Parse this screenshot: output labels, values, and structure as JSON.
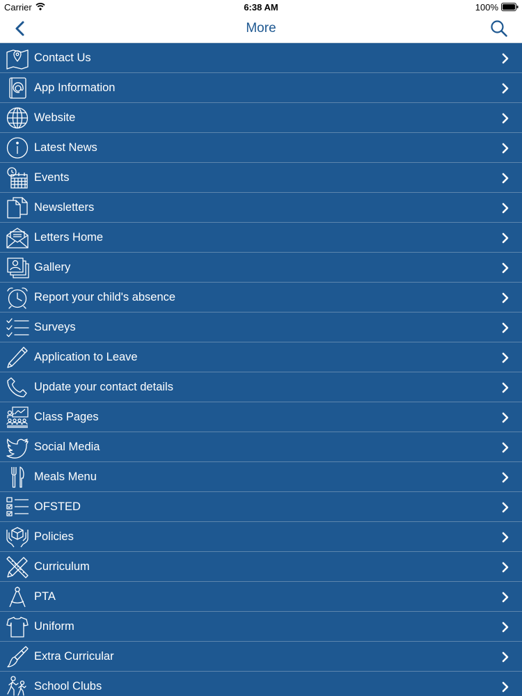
{
  "status_bar": {
    "carrier": "Carrier",
    "time": "6:38 AM",
    "battery": "100%"
  },
  "header": {
    "title": "More",
    "back_icon": "chevron-left-icon",
    "search_icon": "search-icon"
  },
  "colors": {
    "row_bg": "#1e5891",
    "divider": "#5c85ad",
    "title": "#1e5891"
  },
  "menu": {
    "items": [
      {
        "label": "Contact Us",
        "icon": "map-pin-icon"
      },
      {
        "label": "App Information",
        "icon": "address-book-icon"
      },
      {
        "label": "Website",
        "icon": "globe-icon"
      },
      {
        "label": "Latest News",
        "icon": "info-icon"
      },
      {
        "label": "Events",
        "icon": "calendar-clock-icon"
      },
      {
        "label": "Newsletters",
        "icon": "document-icon"
      },
      {
        "label": "Letters Home",
        "icon": "envelope-icon"
      },
      {
        "label": "Gallery",
        "icon": "photos-icon"
      },
      {
        "label": "Report your child's absence",
        "icon": "alarm-clock-icon"
      },
      {
        "label": "Surveys",
        "icon": "checklist-icon"
      },
      {
        "label": "Application to Leave",
        "icon": "pencil-icon"
      },
      {
        "label": "Update your contact details",
        "icon": "phone-icon"
      },
      {
        "label": "Class Pages",
        "icon": "classroom-icon"
      },
      {
        "label": "Social Media",
        "icon": "twitter-bird-icon"
      },
      {
        "label": "Meals Menu",
        "icon": "fork-knife-icon"
      },
      {
        "label": "OFSTED",
        "icon": "checkbox-list-icon"
      },
      {
        "label": "Policies",
        "icon": "hands-box-icon"
      },
      {
        "label": "Curriculum",
        "icon": "pencil-ruler-icon"
      },
      {
        "label": "PTA",
        "icon": "compass-icon"
      },
      {
        "label": "Uniform",
        "icon": "t-shirt-icon"
      },
      {
        "label": "Extra Curricular",
        "icon": "paintbrush-icon"
      },
      {
        "label": "School Clubs",
        "icon": "people-walking-icon"
      }
    ]
  }
}
